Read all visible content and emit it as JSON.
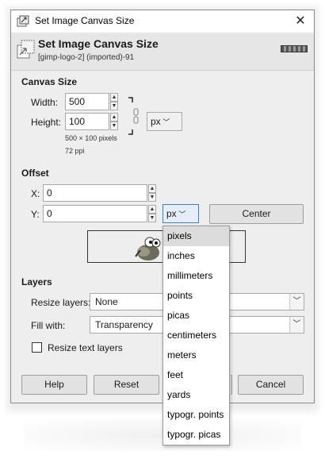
{
  "window": {
    "title": "Set Image Canvas Size",
    "close_glyph": "✕"
  },
  "header": {
    "title": "Set Image Canvas Size",
    "subtitle": "[gimp-logo-2] (imported)-91"
  },
  "canvas_size": {
    "section_label": "Canvas Size",
    "width_label": "Width:",
    "width_value": "500",
    "height_label": "Height:",
    "height_value": "100",
    "unit": "px",
    "dimensions_text": "500 × 100 pixels",
    "resolution_text": "72 ppi"
  },
  "offset": {
    "section_label": "Offset",
    "x_label": "X:",
    "x_value": "0",
    "y_label": "Y:",
    "y_value": "0",
    "unit": "px",
    "center_label": "Center"
  },
  "layers": {
    "section_label": "Layers",
    "resize_label": "Resize layers:",
    "resize_value": "None",
    "fill_label": "Fill with:",
    "fill_value": "Transparency",
    "resize_text_label": "Resize text layers"
  },
  "buttons": {
    "help": "Help",
    "reset": "Reset",
    "cancel": "Cancel"
  },
  "unit_menu": {
    "selected": "pixels",
    "items": [
      "pixels",
      "inches",
      "millimeters",
      "points",
      "picas",
      "centimeters",
      "meters",
      "feet",
      "yards",
      "typogr. points",
      "typogr. picas"
    ]
  },
  "icons": {
    "app": "canvas-size-icon",
    "header": "canvas-size-icon",
    "chain": "chain-link-icon",
    "preview": "wilber-icon"
  },
  "colors": {
    "window_bg": "#eeeeee",
    "header_bg": "#e6e6e6",
    "selected_item_bg": "#dcdcdc",
    "highlight_border": "#3c7fd1"
  }
}
